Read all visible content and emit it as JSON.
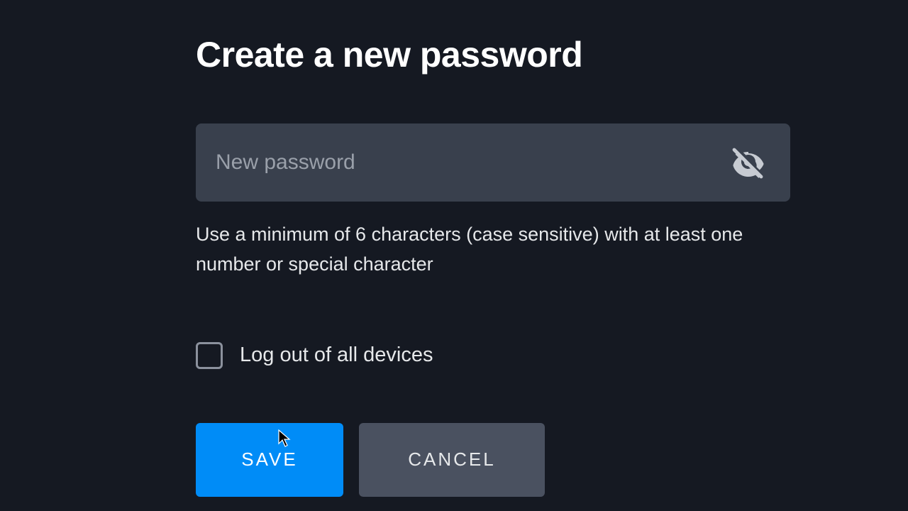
{
  "heading": "Create a new password",
  "password": {
    "placeholder": "New password",
    "value": ""
  },
  "hint": "Use a minimum of 6 characters (case sensitive) with at least one number or special character",
  "checkbox_label": "Log out of all devices",
  "buttons": {
    "save": "SAVE",
    "cancel": "CANCEL"
  },
  "colors": {
    "primary": "#008cf7",
    "secondary_button": "#4a5160",
    "input_bg": "#39404d",
    "page_bg": "#151922"
  }
}
